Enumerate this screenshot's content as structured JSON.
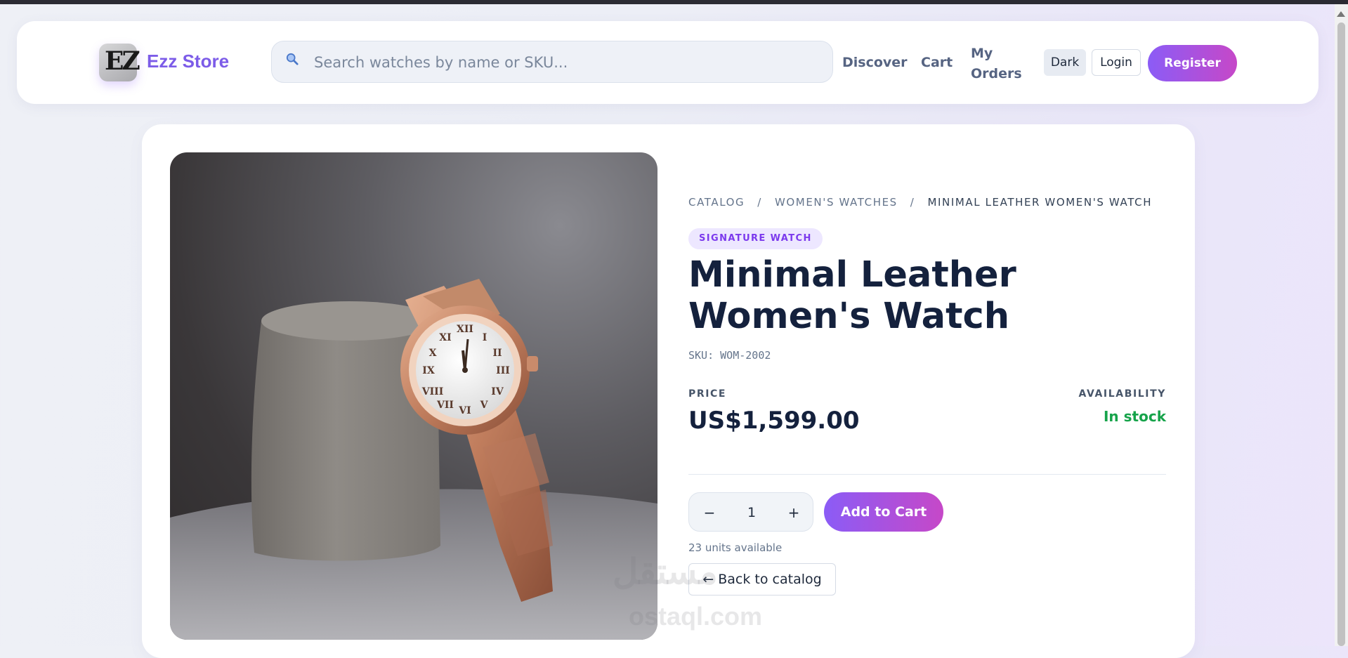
{
  "brand": {
    "name": "Ezz Store",
    "logo_text": "EZ"
  },
  "search": {
    "placeholder": "Search watches by name or SKU...",
    "icon": "search-icon"
  },
  "nav": {
    "discover": "Discover",
    "cart": "Cart",
    "orders": "My Orders",
    "theme": "Dark",
    "login": "Login",
    "register": "Register"
  },
  "breadcrumb": [
    {
      "label": "CATALOG"
    },
    {
      "label": "WOMEN'S WATCHES"
    },
    {
      "label": "MINIMAL LEATHER WOMEN'S WATCH"
    }
  ],
  "product": {
    "badge": "SIGNATURE WATCH",
    "title": "Minimal Leather Women's Watch",
    "sku": "SKU: WOM-2002",
    "price_label": "PRICE",
    "price": "US$1,599.00",
    "availability_label": "AVAILABILITY",
    "availability": "In stock",
    "quantity": "1",
    "units_available": "23 units available",
    "add_to_cart": "Add to Cart",
    "back": "← Back to catalog",
    "image_alt": "Rose gold women's watch displayed on a grey velvet stand"
  },
  "watermark": {
    "line1": "مستقل",
    "line2": "ostaql.com"
  },
  "colors": {
    "accent": "#8b5cf6",
    "accent_end": "#c648c8",
    "brand_text": "#7c5ce8",
    "in_stock": "#16a34a"
  }
}
